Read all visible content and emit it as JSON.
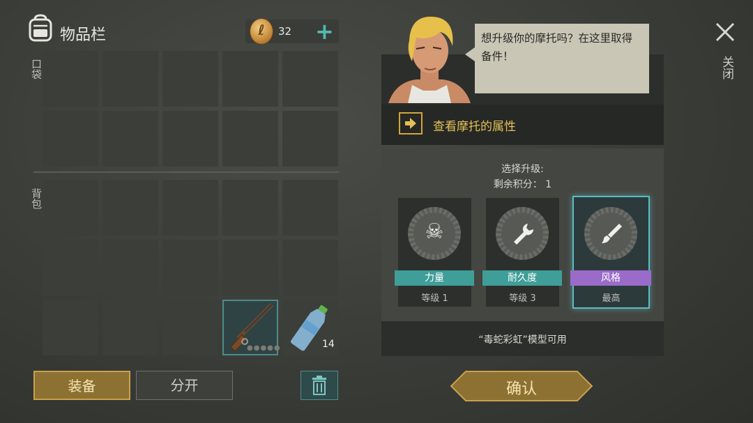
{
  "inventory": {
    "title": "物品栏",
    "coins": "32",
    "pocket_label": "口袋",
    "backpack_label": "背包",
    "water_qty": "14"
  },
  "buttons": {
    "equip": "装备",
    "split": "分开",
    "confirm": "确认",
    "close": "关闭"
  },
  "dialog": {
    "speech": "想升级你的摩托吗？在这里取得备件！",
    "view_bike": "查看摩托的属性"
  },
  "upgrade": {
    "select_label": "选择升级:",
    "points_label": "剩余积分： 1",
    "cards": [
      {
        "name": "力量",
        "level": "等级 1",
        "icon": "skull-crossbones-icon"
      },
      {
        "name": "耐久度",
        "level": "等级 3",
        "icon": "wrench-icon"
      },
      {
        "name": "风格",
        "level": "最高",
        "icon": "brush-icon"
      }
    ],
    "model_available": "“毒蛇彩虹”模型可用"
  },
  "colors": {
    "teal": "#3f9e98",
    "purple": "#9a6bc9",
    "gold": "#c9a24c",
    "accent_plus": "#4fbab2"
  }
}
